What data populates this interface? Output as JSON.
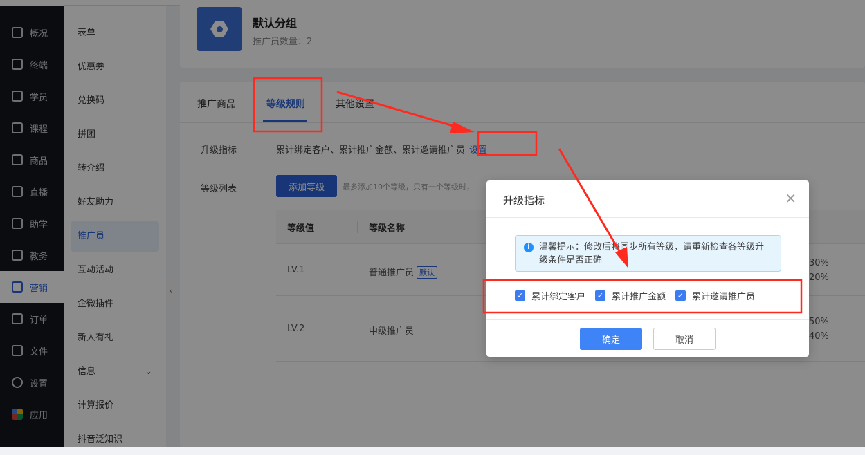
{
  "sidebar": {
    "items": [
      {
        "label": "概况",
        "icon": "grid-icon"
      },
      {
        "label": "终端",
        "icon": "store-icon"
      },
      {
        "label": "学员",
        "icon": "users-icon"
      },
      {
        "label": "课程",
        "icon": "course-icon"
      },
      {
        "label": "商品",
        "icon": "bag-icon"
      },
      {
        "label": "直播",
        "icon": "camera-icon"
      },
      {
        "label": "助学",
        "icon": "gamepad-icon"
      },
      {
        "label": "教务",
        "icon": "columns-icon"
      },
      {
        "label": "营销",
        "icon": "ticket-icon",
        "active": true
      },
      {
        "label": "订单",
        "icon": "clipboard-icon"
      },
      {
        "label": "文件",
        "icon": "folder-icon"
      },
      {
        "label": "设置",
        "icon": "gear-icon"
      },
      {
        "label": "应用",
        "icon": "apps-icon"
      }
    ]
  },
  "submenu": {
    "items": [
      "表单",
      "优惠券",
      "兑换码",
      "拼团",
      "转介绍",
      "好友助力",
      "推广员",
      "互动活动",
      "企微插件",
      "新人有礼",
      "信息",
      "计算报价",
      "抖音泛知识"
    ],
    "active": "推广员"
  },
  "group": {
    "title": "默认分组",
    "count": "推广员数量：2"
  },
  "tabs": [
    "推广商品",
    "等级规则",
    "其他设置"
  ],
  "rules": {
    "metrics_label": "升级指标",
    "metrics_value": "累计绑定客户、累计推广金额、累计邀请推广员",
    "metrics_link": "设置",
    "list_label": "等级列表",
    "add_button": "添加等级",
    "add_hint": "最多添加10个等级，只有一个等级时，",
    "columns": [
      "等级值",
      "等级名称"
    ],
    "rows": [
      {
        "level": "LV.1",
        "name": "普通推广员",
        "tag": "默认",
        "rates": [
          "30%",
          "20%"
        ]
      },
      {
        "level": "LV.2",
        "name": "中级推广员",
        "tag": null,
        "rates": [
          "50%",
          "40%"
        ]
      }
    ]
  },
  "modal": {
    "title": "升级指标",
    "alert": "温馨提示：修改后将同步所有等级，请重新检查各等级升级条件是否正确",
    "options": [
      {
        "label": "累计绑定客户",
        "checked": true
      },
      {
        "label": "累计推广金额",
        "checked": true
      },
      {
        "label": "累计邀请推广员",
        "checked": true
      }
    ],
    "confirm": "确定",
    "cancel": "取消"
  },
  "colors": {
    "accent": "#2b62d9",
    "annotation": "#ff2a1f"
  }
}
